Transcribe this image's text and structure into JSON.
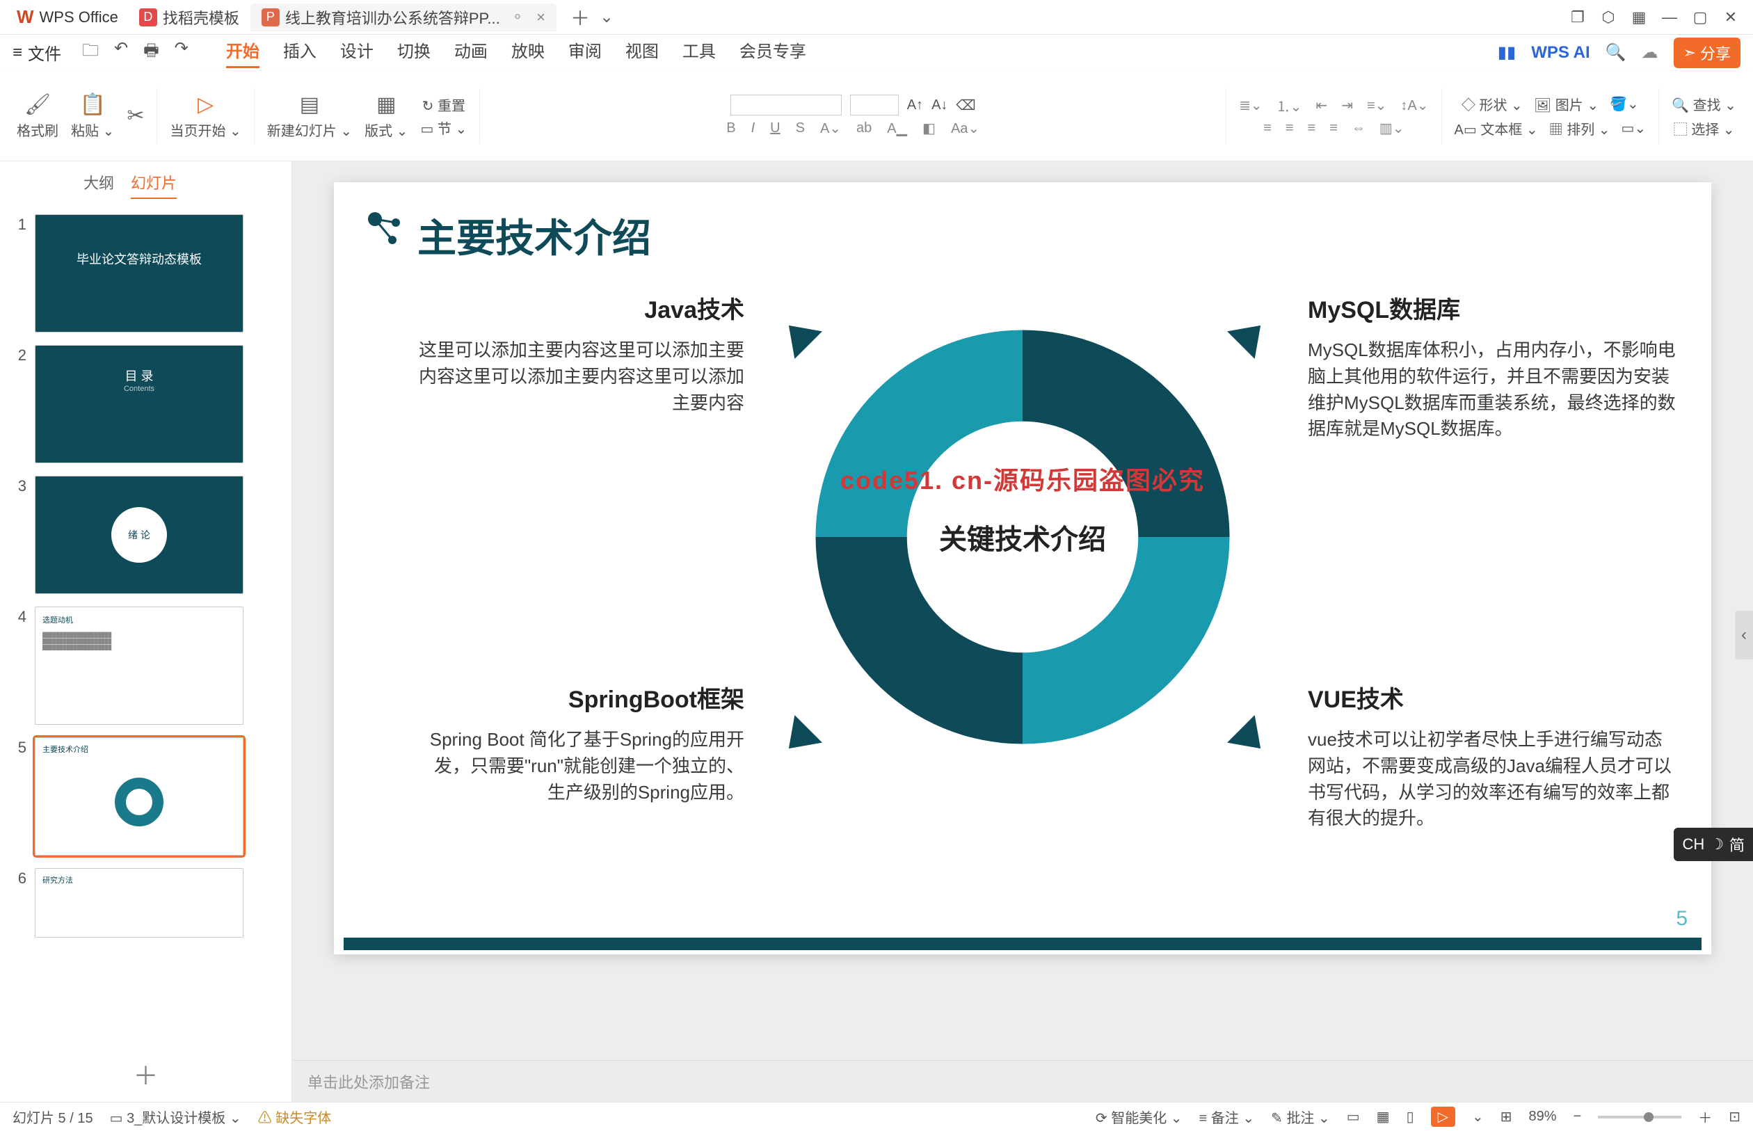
{
  "titlebar": {
    "app_name": "WPS Office",
    "tab_template": "找稻壳模板",
    "tab_doc": "线上教育培训办公系统答辩PP...",
    "tab_badge_template": "D",
    "tab_badge_doc": "P",
    "close": "×",
    "add": "＋",
    "dropdown": "⌄"
  },
  "menubar": {
    "file": "文件",
    "tabs": [
      "开始",
      "插入",
      "设计",
      "切换",
      "动画",
      "放映",
      "审阅",
      "视图",
      "工具",
      "会员专享"
    ],
    "ai": "WPS AI",
    "share": "分享"
  },
  "ribbon": {
    "format_brush": "格式刷",
    "paste": "粘贴",
    "from_current": "当页开始",
    "new_slide": "新建幻灯片",
    "layout": "版式",
    "section": "节",
    "reset": "重置",
    "shape": "形状",
    "image": "图片",
    "textbox": "文本框",
    "arrange": "排列",
    "find": "查找",
    "select": "选择"
  },
  "sidepanel": {
    "tab_outline": "大纲",
    "tab_slides": "幻灯片",
    "thumb1_title": "毕业论文答辩动态模板",
    "thumb2_title": "目 录",
    "thumb2_sub": "Contents",
    "thumb3_title": "绪 论",
    "thumb4_title": "选题动机",
    "thumb5_title": "主要技术介绍",
    "thumb6_title": "研究方法",
    "add": "＋"
  },
  "slide": {
    "title": "主要技术介绍",
    "center": "关键技术介绍",
    "page": "5",
    "watermark": "code51. cn-源码乐园盗图必究",
    "q_tl_title": "Java技术",
    "q_tl_body": "这里可以添加主要内容这里可以添加主要内容这里可以添加主要内容这里可以添加主要内容",
    "q_tr_title": "MySQL数据库",
    "q_tr_body": "MySQL数据库体积小，占用内存小，不影响电脑上其他用的软件运行，并且不需要因为安装维护MySQL数据库而重装系统，最终选择的数据库就是MySQL数据库。",
    "q_bl_title": "SpringBoot框架",
    "q_bl_body": "Spring Boot 简化了基于Spring的应用开发，只需要\"run\"就能创建一个独立的、生产级别的Spring应用。",
    "q_br_title": "VUE技术",
    "q_br_body": "vue技术可以让初学者尽快上手进行编写动态网站，不需要变成高级的Java编程人员才可以书写代码，从学习的效率还有编写的效率上都有很大的提升。"
  },
  "notes": {
    "placeholder": "单击此处添加备注"
  },
  "status": {
    "slide_pos": "幻灯片 5 / 15",
    "template": "3_默认设计模板",
    "missing_font": "缺失字体",
    "beautify": "智能美化",
    "remark": "备注",
    "review": "批注",
    "zoom": "89%"
  },
  "ime": {
    "lang": "CH",
    "mode": "简"
  }
}
